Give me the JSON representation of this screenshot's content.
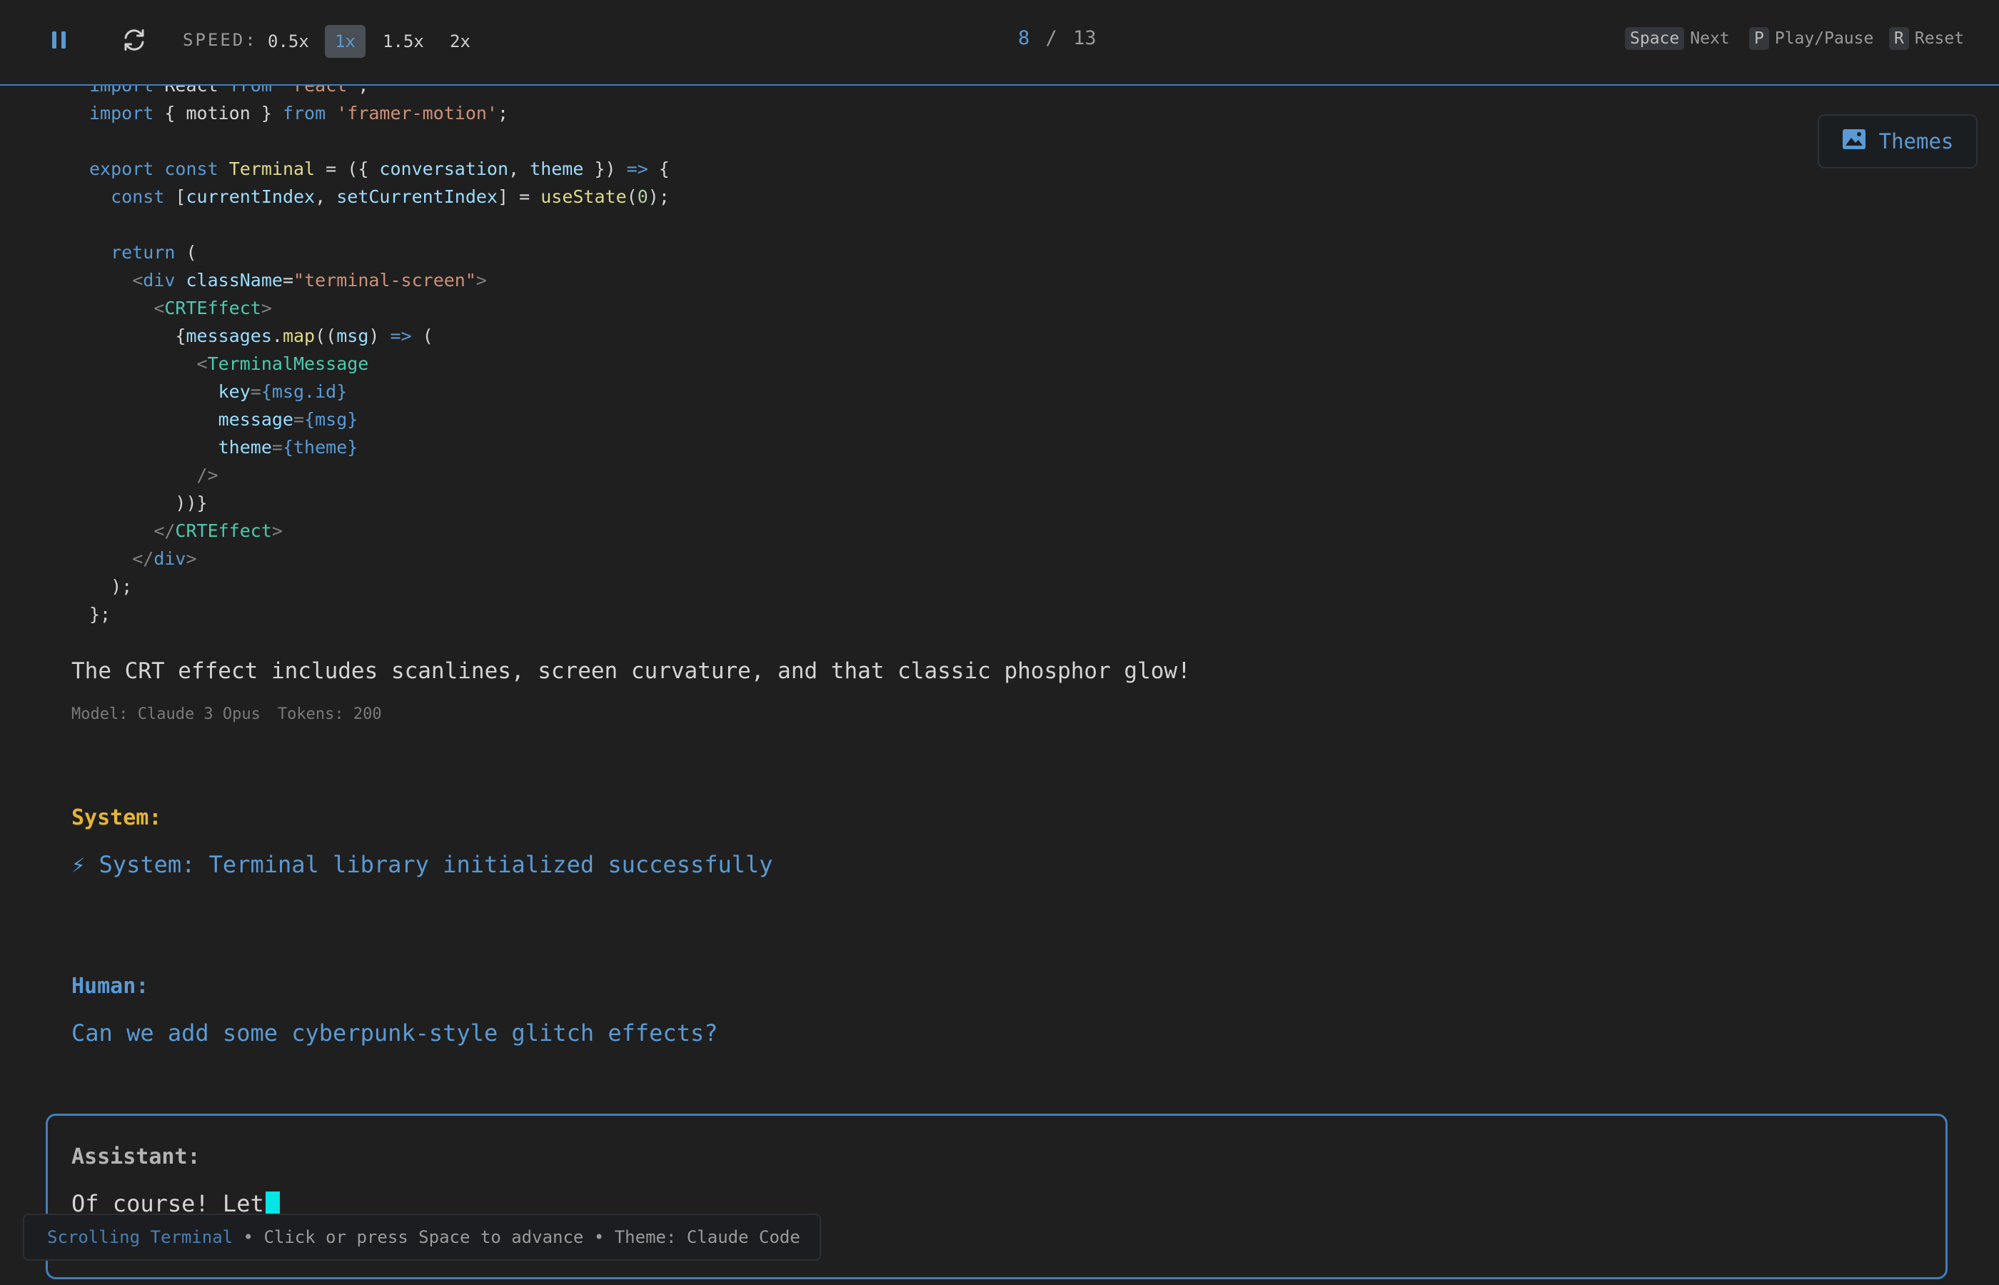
{
  "toolbar": {
    "pause_icon": "pause-icon",
    "reset_icon": "refresh-icon",
    "speed_label": "SPEED:",
    "speeds": [
      "0.5x",
      "1x",
      "1.5x",
      "2x"
    ],
    "active_speed": "1x",
    "counter_current": "8",
    "counter_sep": "/",
    "counter_total": "13",
    "shortcuts": [
      {
        "key": "Space",
        "label": "Next"
      },
      {
        "key": "P",
        "label": "Play/Pause"
      },
      {
        "key": "R",
        "label": "Reset"
      }
    ]
  },
  "themes_button": {
    "label": "Themes",
    "icon": "image-icon"
  },
  "code_lines": [
    "import React from 'react';",
    "import { motion } from 'framer-motion';",
    "",
    "export const Terminal = ({ conversation, theme }) => {",
    "  const [currentIndex, setCurrentIndex] = useState(0);",
    "",
    "  return (",
    "    <div className=\"terminal-screen\">",
    "      <CRTEffect>",
    "        {messages.map((msg) => (",
    "          <TerminalMessage",
    "            key={msg.id}",
    "            message={msg}",
    "            theme={theme}",
    "          />",
    "        ))}",
    "      </CRTEffect>",
    "    </div>",
    "  );",
    "};"
  ],
  "assistant_prev": {
    "text": "The CRT effect includes scanlines, screen curvature, and that classic phosphor glow!",
    "model": "Model: Claude 3 Opus",
    "tokens": "Tokens: 200"
  },
  "system_msg": {
    "heading": "System:",
    "text": "⚡ System: Terminal library initialized successfully"
  },
  "human_msg": {
    "heading": "Human:",
    "text": "Can we add some cyberpunk-style glitch effects?"
  },
  "assistant_current": {
    "heading": "Assistant:",
    "text": "Of course! Let"
  },
  "status_bar": {
    "name": "Scrolling Terminal",
    "rest": " • Click or press Space to advance • Theme: Claude Code"
  },
  "colors": {
    "accent": "#5a9ad5",
    "system": "#e5b53a",
    "cursor": "#00e5e5",
    "background": "#1f1f1f"
  }
}
